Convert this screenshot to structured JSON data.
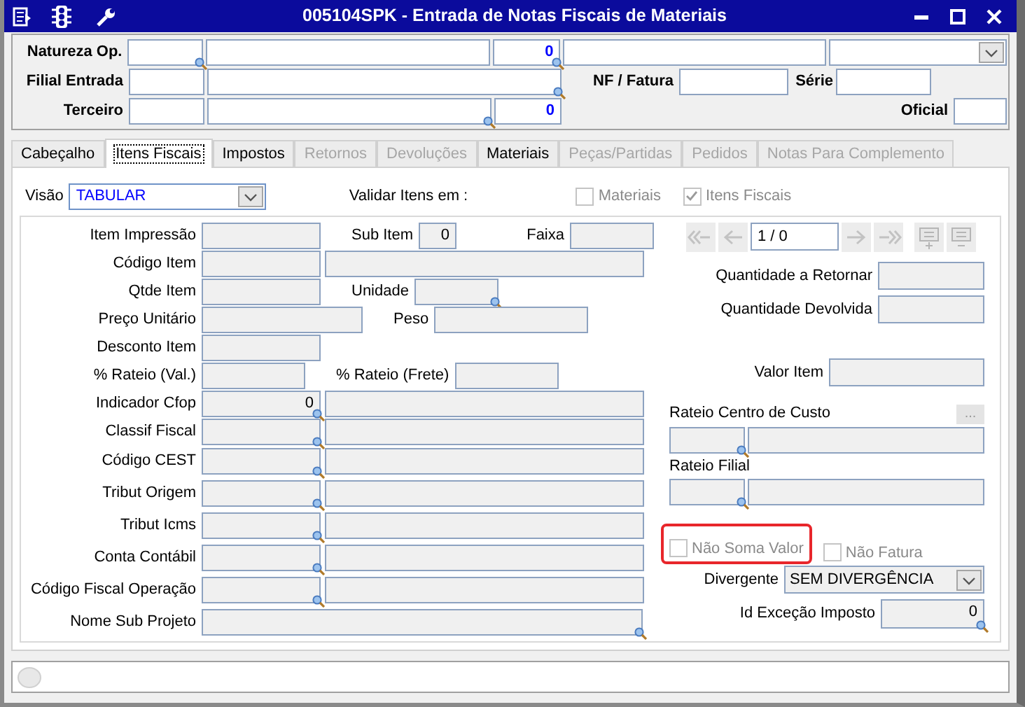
{
  "window": {
    "title": "005104SPK - Entrada de Notas Fiscais de Materiais"
  },
  "header": {
    "natureza_op": {
      "label": "Natureza Op.",
      "number": "0"
    },
    "filial_entrada": {
      "label": "Filial Entrada"
    },
    "nf_fatura": {
      "label": "NF / Fatura"
    },
    "serie": {
      "label": "Série"
    },
    "terceiro": {
      "label": "Terceiro",
      "number": "0"
    },
    "oficial": {
      "label": "Oficial"
    }
  },
  "tabs": [
    {
      "label": "Cabeçalho",
      "selected": false,
      "disabled": false
    },
    {
      "label": "Itens Fiscais",
      "selected": true,
      "disabled": false
    },
    {
      "label": "Impostos",
      "selected": false,
      "disabled": false
    },
    {
      "label": "Retornos",
      "selected": false,
      "disabled": true
    },
    {
      "label": "Devoluções",
      "selected": false,
      "disabled": true
    },
    {
      "label": "Materiais",
      "selected": false,
      "disabled": false
    },
    {
      "label": "Peças/Partidas",
      "selected": false,
      "disabled": true
    },
    {
      "label": "Pedidos",
      "selected": false,
      "disabled": true
    },
    {
      "label": "Notas Para Complemento",
      "selected": false,
      "disabled": true
    }
  ],
  "visao": {
    "label": "Visão",
    "value": "TABULAR"
  },
  "validar": {
    "label": "Validar Itens em :",
    "options": [
      {
        "label": "Materiais",
        "checked": false
      },
      {
        "label": "Itens Fiscais",
        "checked": true
      }
    ]
  },
  "left_rows": [
    {
      "label": "Item Impressão",
      "kind": "short",
      "lookup": false,
      "extras": [
        {
          "label": "Sub Item",
          "kind": "narrow",
          "value": "0",
          "lookup": false
        },
        {
          "label": "Faixa",
          "kind": "short",
          "lookup": false
        }
      ]
    },
    {
      "label": "Código Item",
      "kind": "pair",
      "lookup": false
    },
    {
      "label": "Qtde Item",
      "kind": "short",
      "lookup": false,
      "extras": [
        {
          "label": "Unidade",
          "kind": "short",
          "lookup": true
        }
      ]
    },
    {
      "label": "Preço Unitário",
      "kind": "medium",
      "lookup": false,
      "extras": [
        {
          "label": "Peso",
          "kind": "long",
          "lookup": false
        }
      ]
    },
    {
      "label": "Desconto Item",
      "kind": "short",
      "lookup": false
    },
    {
      "label": "% Rateio (Val.)",
      "kind": "narrow",
      "lookup": false,
      "extras": [
        {
          "label": "% Rateio (Frete)",
          "kind": "medium",
          "lookup": false
        }
      ]
    },
    {
      "label": "Indicador Cfop",
      "kind": "pair",
      "value": "0",
      "lookup": true
    },
    {
      "label": "Classif Fiscal",
      "kind": "pair",
      "lookup": true
    },
    {
      "label": "Código CEST",
      "kind": "pair",
      "lookup": true
    },
    {
      "label": "Tribut Origem",
      "kind": "pair",
      "lookup": true
    },
    {
      "label": "Tribut Icms",
      "kind": "pair",
      "lookup": true
    },
    {
      "label": "Conta Contábil",
      "kind": "pair",
      "lookup": true
    },
    {
      "label": "Código Fiscal Operação",
      "kind": "pair",
      "lookup": true
    },
    {
      "label": "Nome Sub Projeto",
      "kind": "wide",
      "lookup": true
    }
  ],
  "navigator": {
    "position": "1 / 0"
  },
  "quantities": [
    {
      "label": "Quantidade a Retornar"
    },
    {
      "label": "Quantidade Devolvida"
    }
  ],
  "valor_item": {
    "label": "Valor Item"
  },
  "rateio_centro_custo": {
    "label": "Rateio Centro de Custo",
    "button": "..."
  },
  "rateio_filial": {
    "label": "Rateio Filial"
  },
  "flags": [
    {
      "label": "Não Soma Valor",
      "checked": false,
      "highlighted": true
    },
    {
      "label": "Não Fatura",
      "checked": false,
      "highlighted": false
    }
  ],
  "divergente": {
    "label": "Divergente",
    "value": "SEM DIVERGÊNCIA"
  },
  "id_excecao": {
    "label": "Id Exceção Imposto",
    "value": "0"
  }
}
